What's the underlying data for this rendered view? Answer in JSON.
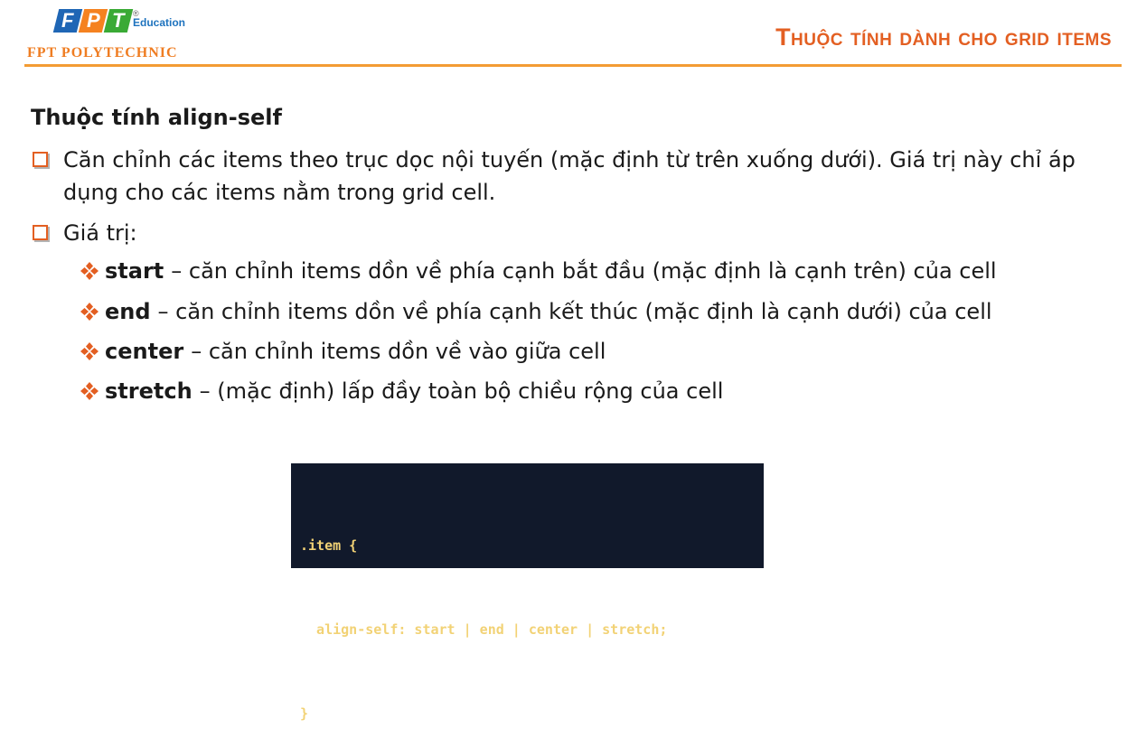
{
  "brand": {
    "logo_letters": [
      "F",
      "P",
      "T"
    ],
    "logo_colors": [
      "#1f66b5",
      "#f58220",
      "#3aaa35"
    ],
    "registered": "®",
    "education": "Education",
    "name": "FPT POLYTECHNIC"
  },
  "slide_title": "Thuộc tính dành cho grid items",
  "section_heading": "Thuộc tính align-self",
  "paragraphs": [
    "Căn chỉnh các items theo trục dọc nội tuyến (mặc định từ trên xuống dưới). Giá trị này chỉ áp dụng cho các items nằm trong grid cell.",
    "Giá trị:"
  ],
  "values": [
    {
      "name": "start",
      "desc": "– căn chỉnh items dồn về phía cạnh bắt đầu (mặc định là cạnh trên) của cell"
    },
    {
      "name": "end",
      "desc": "– căn chỉnh items dồn về phía cạnh kết thúc (mặc định là cạnh dưới) của cell"
    },
    {
      "name": "center",
      "desc": "– căn chỉnh items dồn về vào giữa cell"
    },
    {
      "name": "stretch",
      "desc": "– (mặc định) lấp đầy toàn bộ chiều rộng của cell"
    }
  ],
  "code_lines": [
    ".item {",
    "  align-self: start | end | center | stretch;",
    "}"
  ],
  "colors": {
    "title": "#e35f22",
    "rule": "#f39c34",
    "bullet": "#e35f22",
    "code_bg": "#11192b",
    "code_text": "#f2d275"
  }
}
